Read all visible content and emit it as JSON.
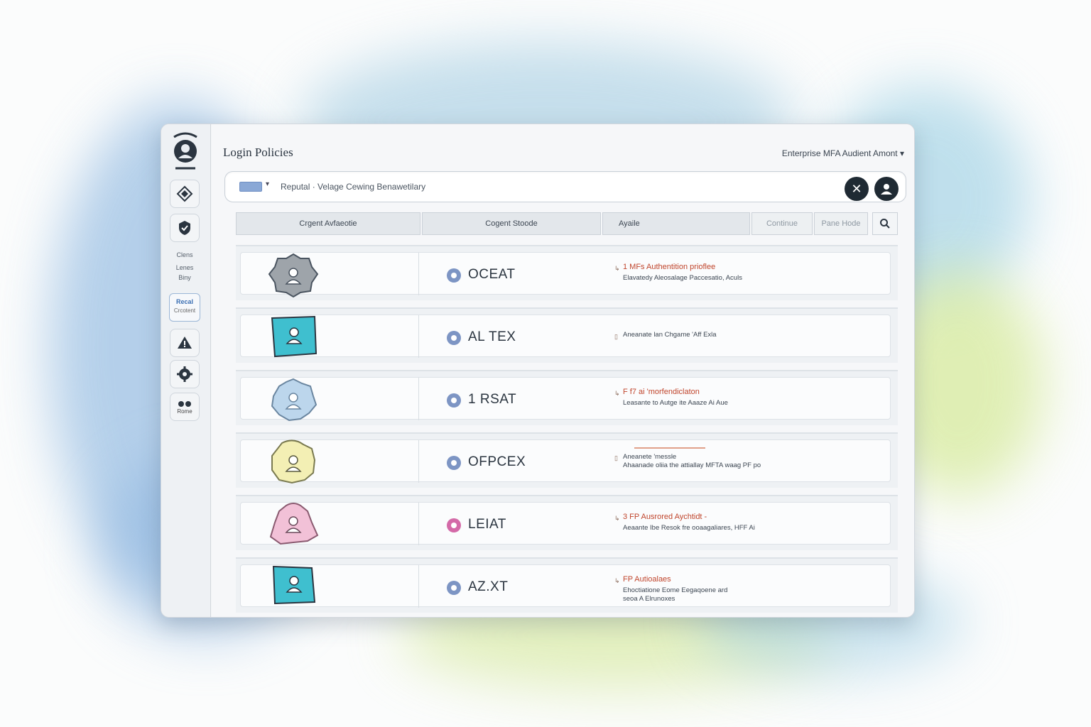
{
  "window": {
    "title": "Login Policies",
    "tenant_selector": "Enterprise MFA Audient Amont ▾"
  },
  "sidebar": {
    "group_text": [
      "Clens",
      "Lenes",
      "Biny"
    ],
    "active_item": {
      "label": "Recal",
      "sub": "Crcotent"
    },
    "bottom_label": "Rome"
  },
  "search": {
    "filter_caret": "▾",
    "breadcrumb": "Reputal · Velage Cewing Benawetilary"
  },
  "table": {
    "headers": {
      "col1": "Crgent Avfaeotie",
      "col2": "Cogent Stoode",
      "col3": "Ayaile",
      "btn_confirm": "Continue",
      "btn_reset": "Pane Hode"
    },
    "rows": [
      {
        "name": "OCEAT",
        "avatar_color": "#9ea4aa",
        "dot_color": "#7d95c4",
        "alert": "1 MFs Authentition prioflee",
        "sub": [
          "Elavatedy Aleosalage Paccesatio, Aculs"
        ]
      },
      {
        "name": "AL TEX",
        "avatar_color": "#3fbfcf",
        "dot_color": "#7d95c4",
        "alert": "",
        "sub": [
          "Aneanate lan Chgame 'Aff Exla"
        ]
      },
      {
        "name": "1 RSAT",
        "avatar_color": "#bcd6ec",
        "dot_color": "#7d95c4",
        "alert": "F f7 ai 'morfendiclaton",
        "sub": [
          "Leasante to Autge ite Aaaze Ai Aue"
        ]
      },
      {
        "name": "OFPCEX",
        "avatar_color": "#f3efb4",
        "dot_color": "#7d95c4",
        "alert": "",
        "sub": [
          "Aneanete 'messle",
          "Ahaanade oliia the attiallay MFTA waag PF po"
        ]
      },
      {
        "name": "LEIAT",
        "avatar_color": "#f2c1d7",
        "dot_color": "#d46aa8",
        "alert": "3 FP Ausrored Aychtidt -",
        "sub": [
          "Aeaante Ibe Resok fre ooaagaliares, HFF Ai"
        ]
      },
      {
        "name": "AZ.XT",
        "avatar_color": "#3fbfcf",
        "dot_color": "#7d95c4",
        "alert": "FP Autioalaes",
        "sub": [
          "Ehoctiatione Eome Eegaqoene ard",
          "seoa A Elrunoxes"
        ]
      }
    ]
  },
  "colors": {
    "accent": "#3b6fb3",
    "alert": "#c0452c",
    "dark_button": "#1f2a33"
  }
}
